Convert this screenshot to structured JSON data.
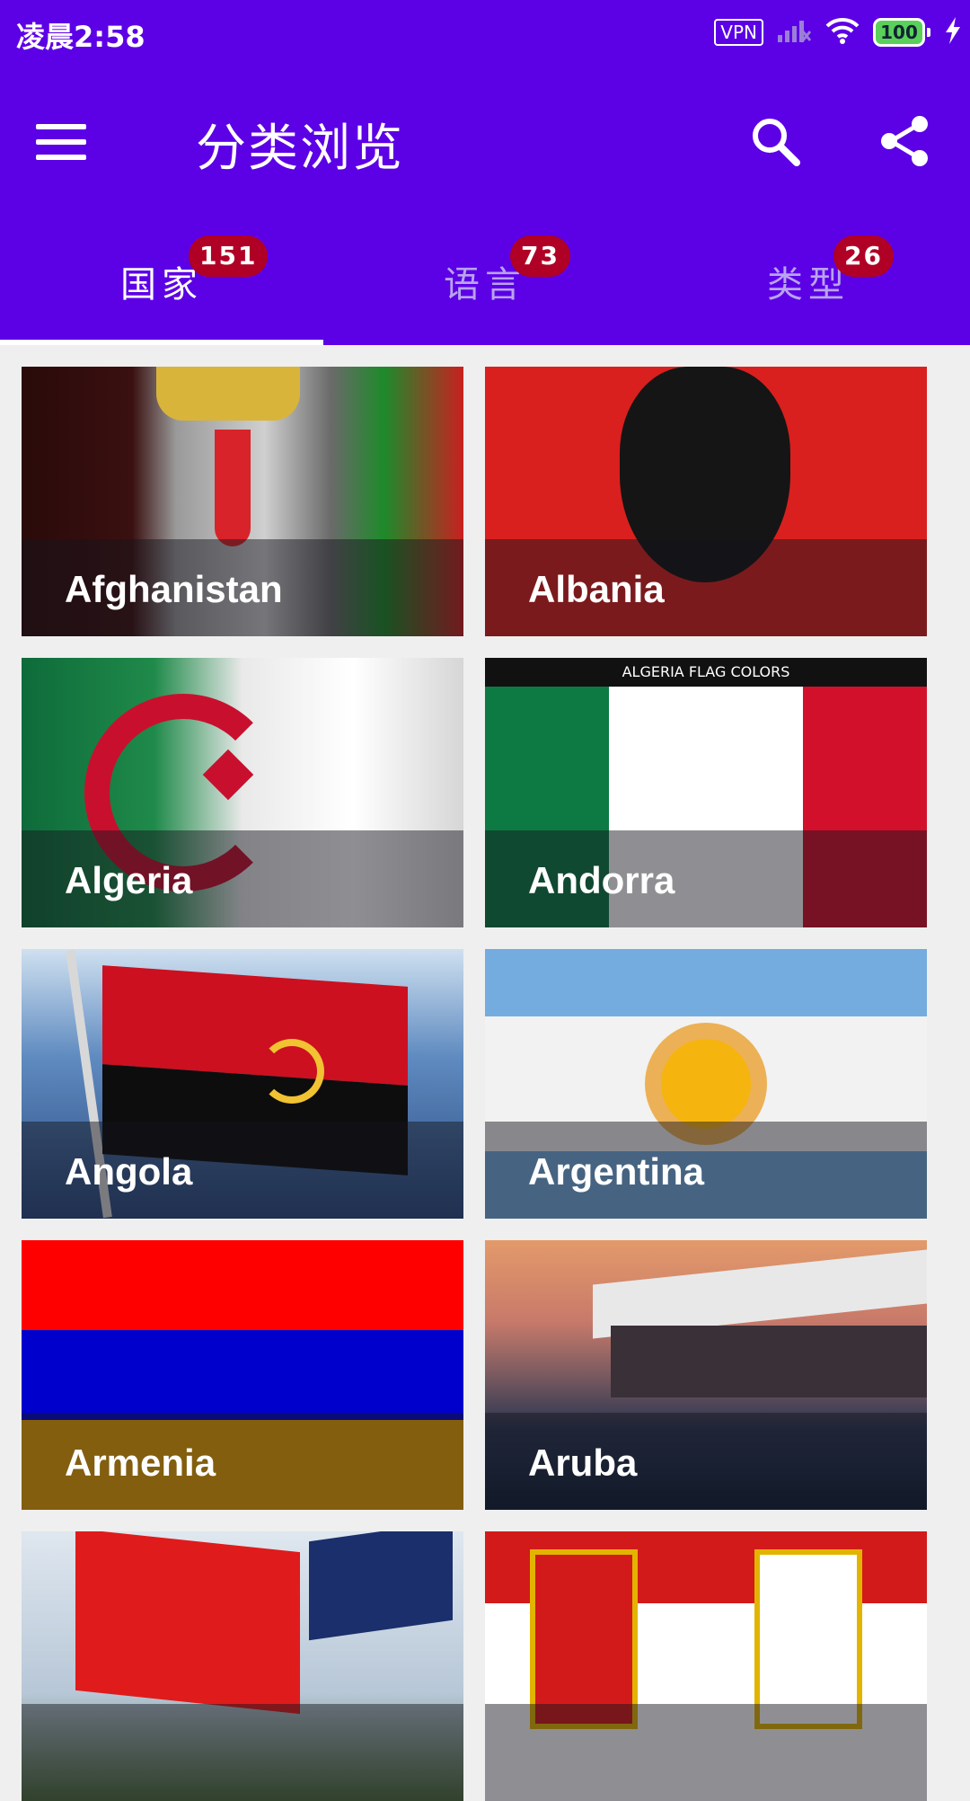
{
  "status": {
    "time": "凌晨2:58",
    "vpn": "VPN",
    "battery": "100"
  },
  "toolbar": {
    "title": "分类浏览"
  },
  "tabs": [
    {
      "label": "国家",
      "count": "151"
    },
    {
      "label": "语言",
      "count": "73"
    },
    {
      "label": "类型",
      "count": "26"
    }
  ],
  "cards": [
    {
      "name": "Afghanistan"
    },
    {
      "name": "Albania"
    },
    {
      "name": "Algeria"
    },
    {
      "name": "Andorra",
      "caption": "ALGERIA FLAG COLORS"
    },
    {
      "name": "Angola"
    },
    {
      "name": "Argentina"
    },
    {
      "name": "Armenia"
    },
    {
      "name": "Aruba"
    },
    {
      "name": ""
    },
    {
      "name": ""
    }
  ],
  "colors": {
    "appbar": "#5c00e6",
    "badge": "#b00025",
    "background": "#efefef"
  }
}
